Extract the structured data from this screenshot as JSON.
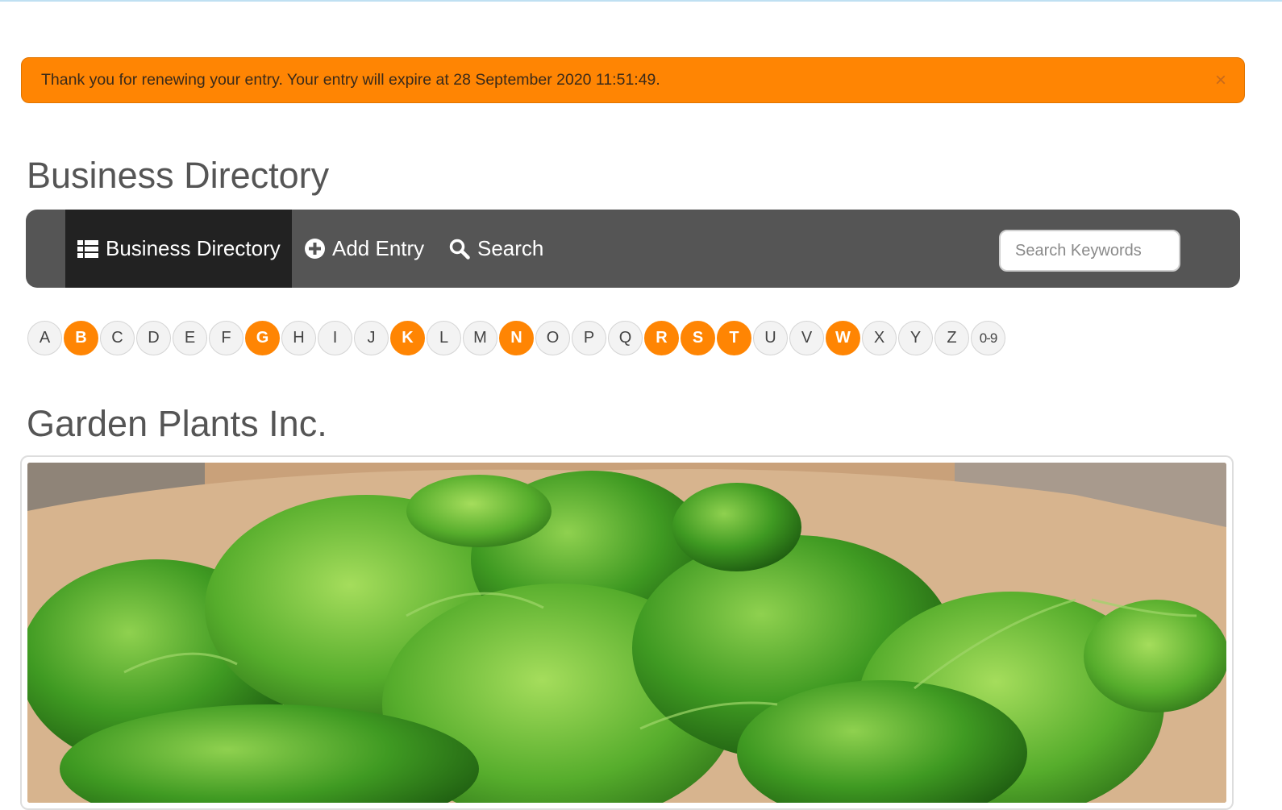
{
  "alert": {
    "message": "Thank you for renewing your entry. Your entry will expire at 28 September 2020 11:51:49.",
    "close_label": "×"
  },
  "page_title": "Business Directory",
  "nav": {
    "items": [
      {
        "label": "Business Directory",
        "icon": "list-icon",
        "active": true
      },
      {
        "label": "Add Entry",
        "icon": "plus-circle-icon",
        "active": false
      },
      {
        "label": "Search",
        "icon": "search-icon",
        "active": false
      }
    ],
    "search_placeholder": "Search Keywords"
  },
  "letters": [
    {
      "label": "A",
      "active": false
    },
    {
      "label": "B",
      "active": true
    },
    {
      "label": "C",
      "active": false
    },
    {
      "label": "D",
      "active": false
    },
    {
      "label": "E",
      "active": false
    },
    {
      "label": "F",
      "active": false
    },
    {
      "label": "G",
      "active": true
    },
    {
      "label": "H",
      "active": false
    },
    {
      "label": "I",
      "active": false
    },
    {
      "label": "J",
      "active": false
    },
    {
      "label": "K",
      "active": true
    },
    {
      "label": "L",
      "active": false
    },
    {
      "label": "M",
      "active": false
    },
    {
      "label": "N",
      "active": true
    },
    {
      "label": "O",
      "active": false
    },
    {
      "label": "P",
      "active": false
    },
    {
      "label": "Q",
      "active": false
    },
    {
      "label": "R",
      "active": true
    },
    {
      "label": "S",
      "active": true
    },
    {
      "label": "T",
      "active": true
    },
    {
      "label": "U",
      "active": false
    },
    {
      "label": "V",
      "active": false
    },
    {
      "label": "W",
      "active": true
    },
    {
      "label": "X",
      "active": false
    },
    {
      "label": "Y",
      "active": false
    },
    {
      "label": "Z",
      "active": false
    },
    {
      "label": "0-9",
      "active": false
    }
  ],
  "entry": {
    "title": "Garden Plants Inc."
  },
  "colors": {
    "accent": "#ff8503",
    "navbar": "#555555",
    "navbar_active": "#222222"
  }
}
